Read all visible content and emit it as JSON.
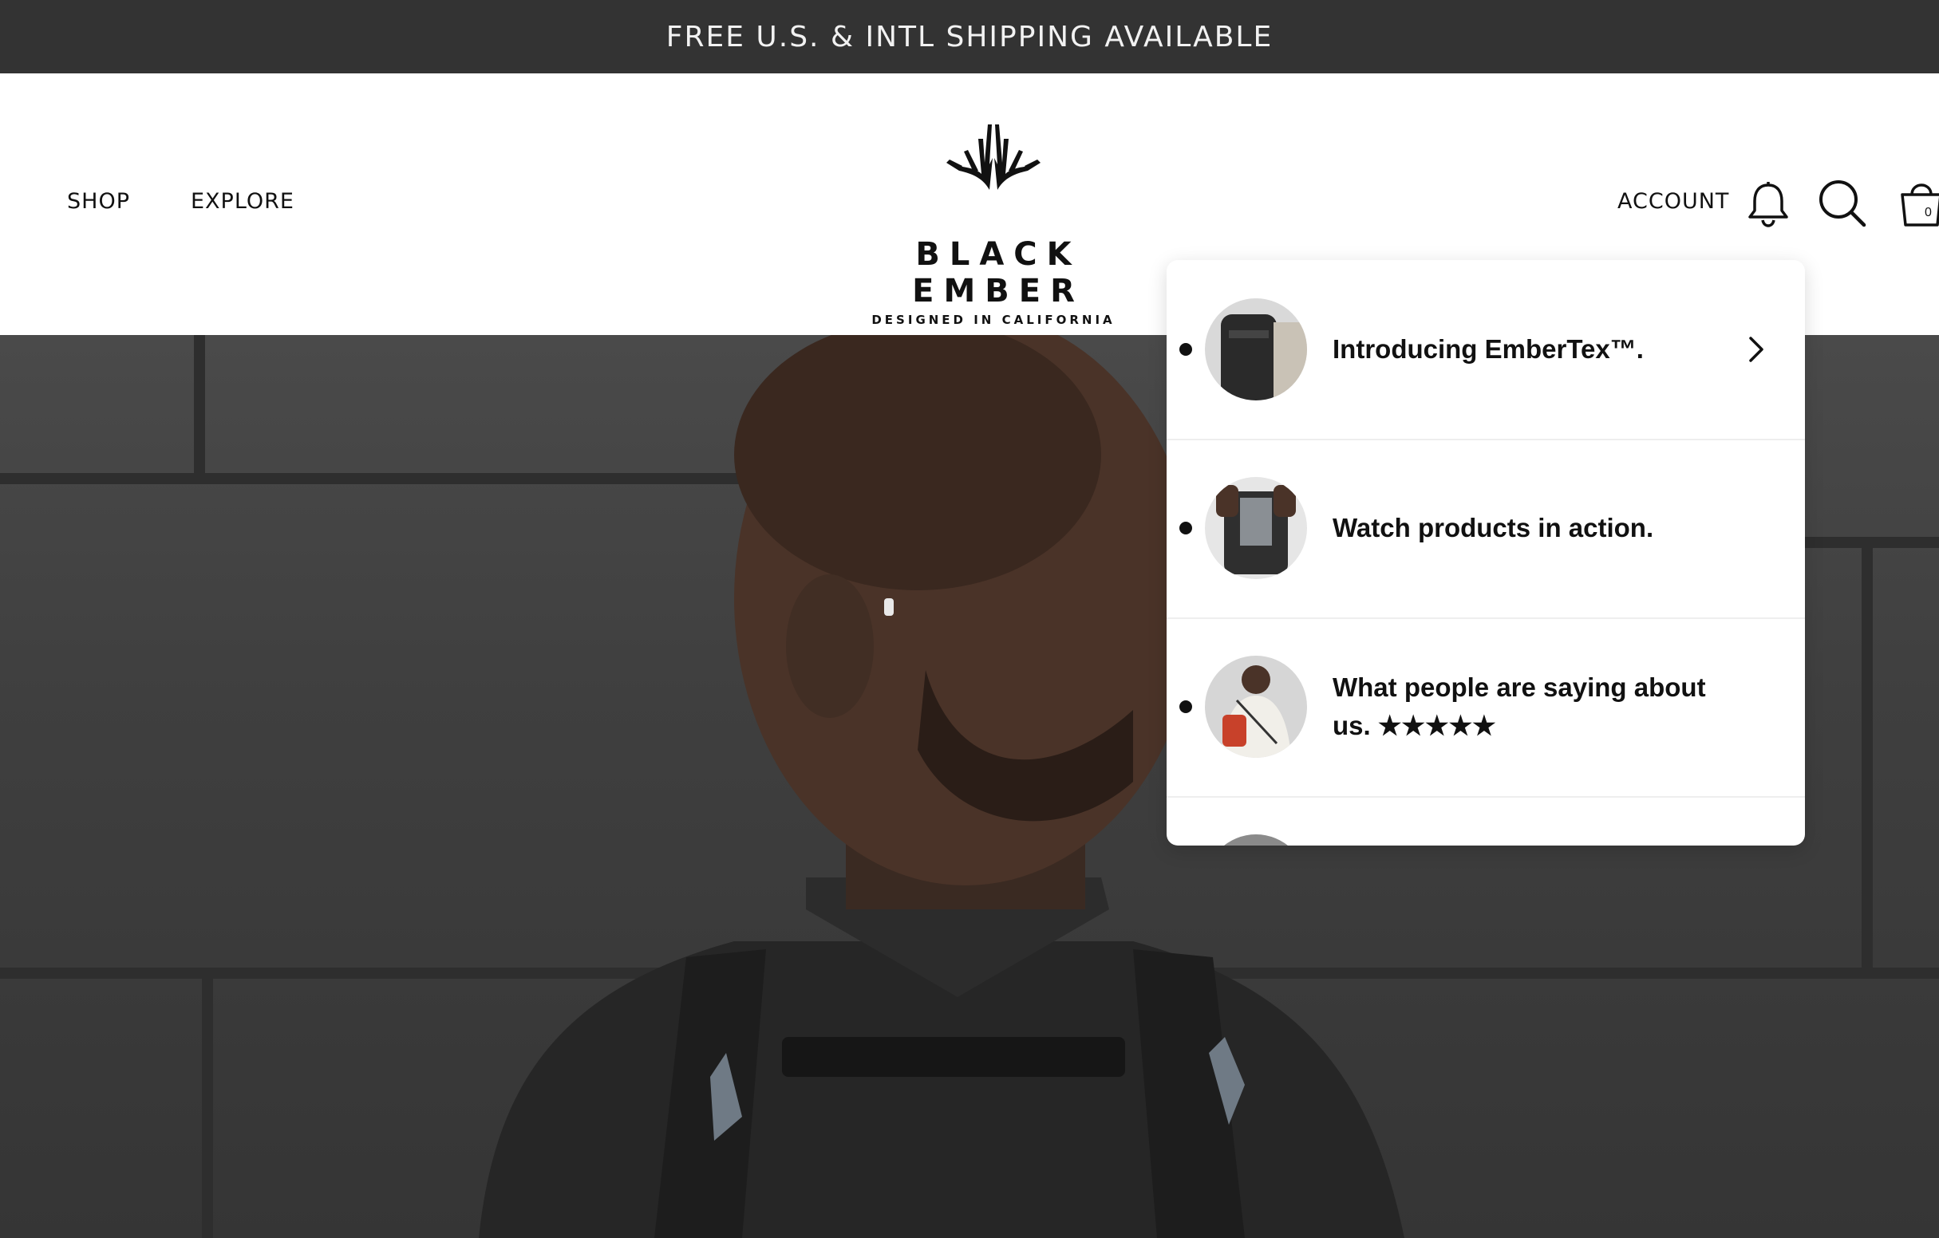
{
  "announcement": {
    "text": "FREE U.S. & INTL SHIPPING AVAILABLE"
  },
  "nav": {
    "items": [
      {
        "label": "SHOP"
      },
      {
        "label": "EXPLORE"
      }
    ]
  },
  "logo": {
    "name": "BLACK EMBER",
    "tagline": "DESIGNED IN CALIFORNIA",
    "icon": "antlers-logo"
  },
  "header_actions": {
    "account_label": "ACCOUNT",
    "icons": [
      "bell-icon",
      "search-icon",
      "shopping-bag-icon"
    ],
    "cart_count": "0"
  },
  "dropdown": {
    "items": [
      {
        "text": "Introducing EmberTex™.",
        "has_chevron": true
      },
      {
        "text": "Watch products in action.",
        "has_chevron": false
      },
      {
        "text": "What people are saying about us. ★★★★★",
        "has_chevron": false
      }
    ]
  },
  "colors": {
    "announce_bg": "#333333",
    "text": "#111111",
    "hero_bg": "#3f3f3f"
  }
}
